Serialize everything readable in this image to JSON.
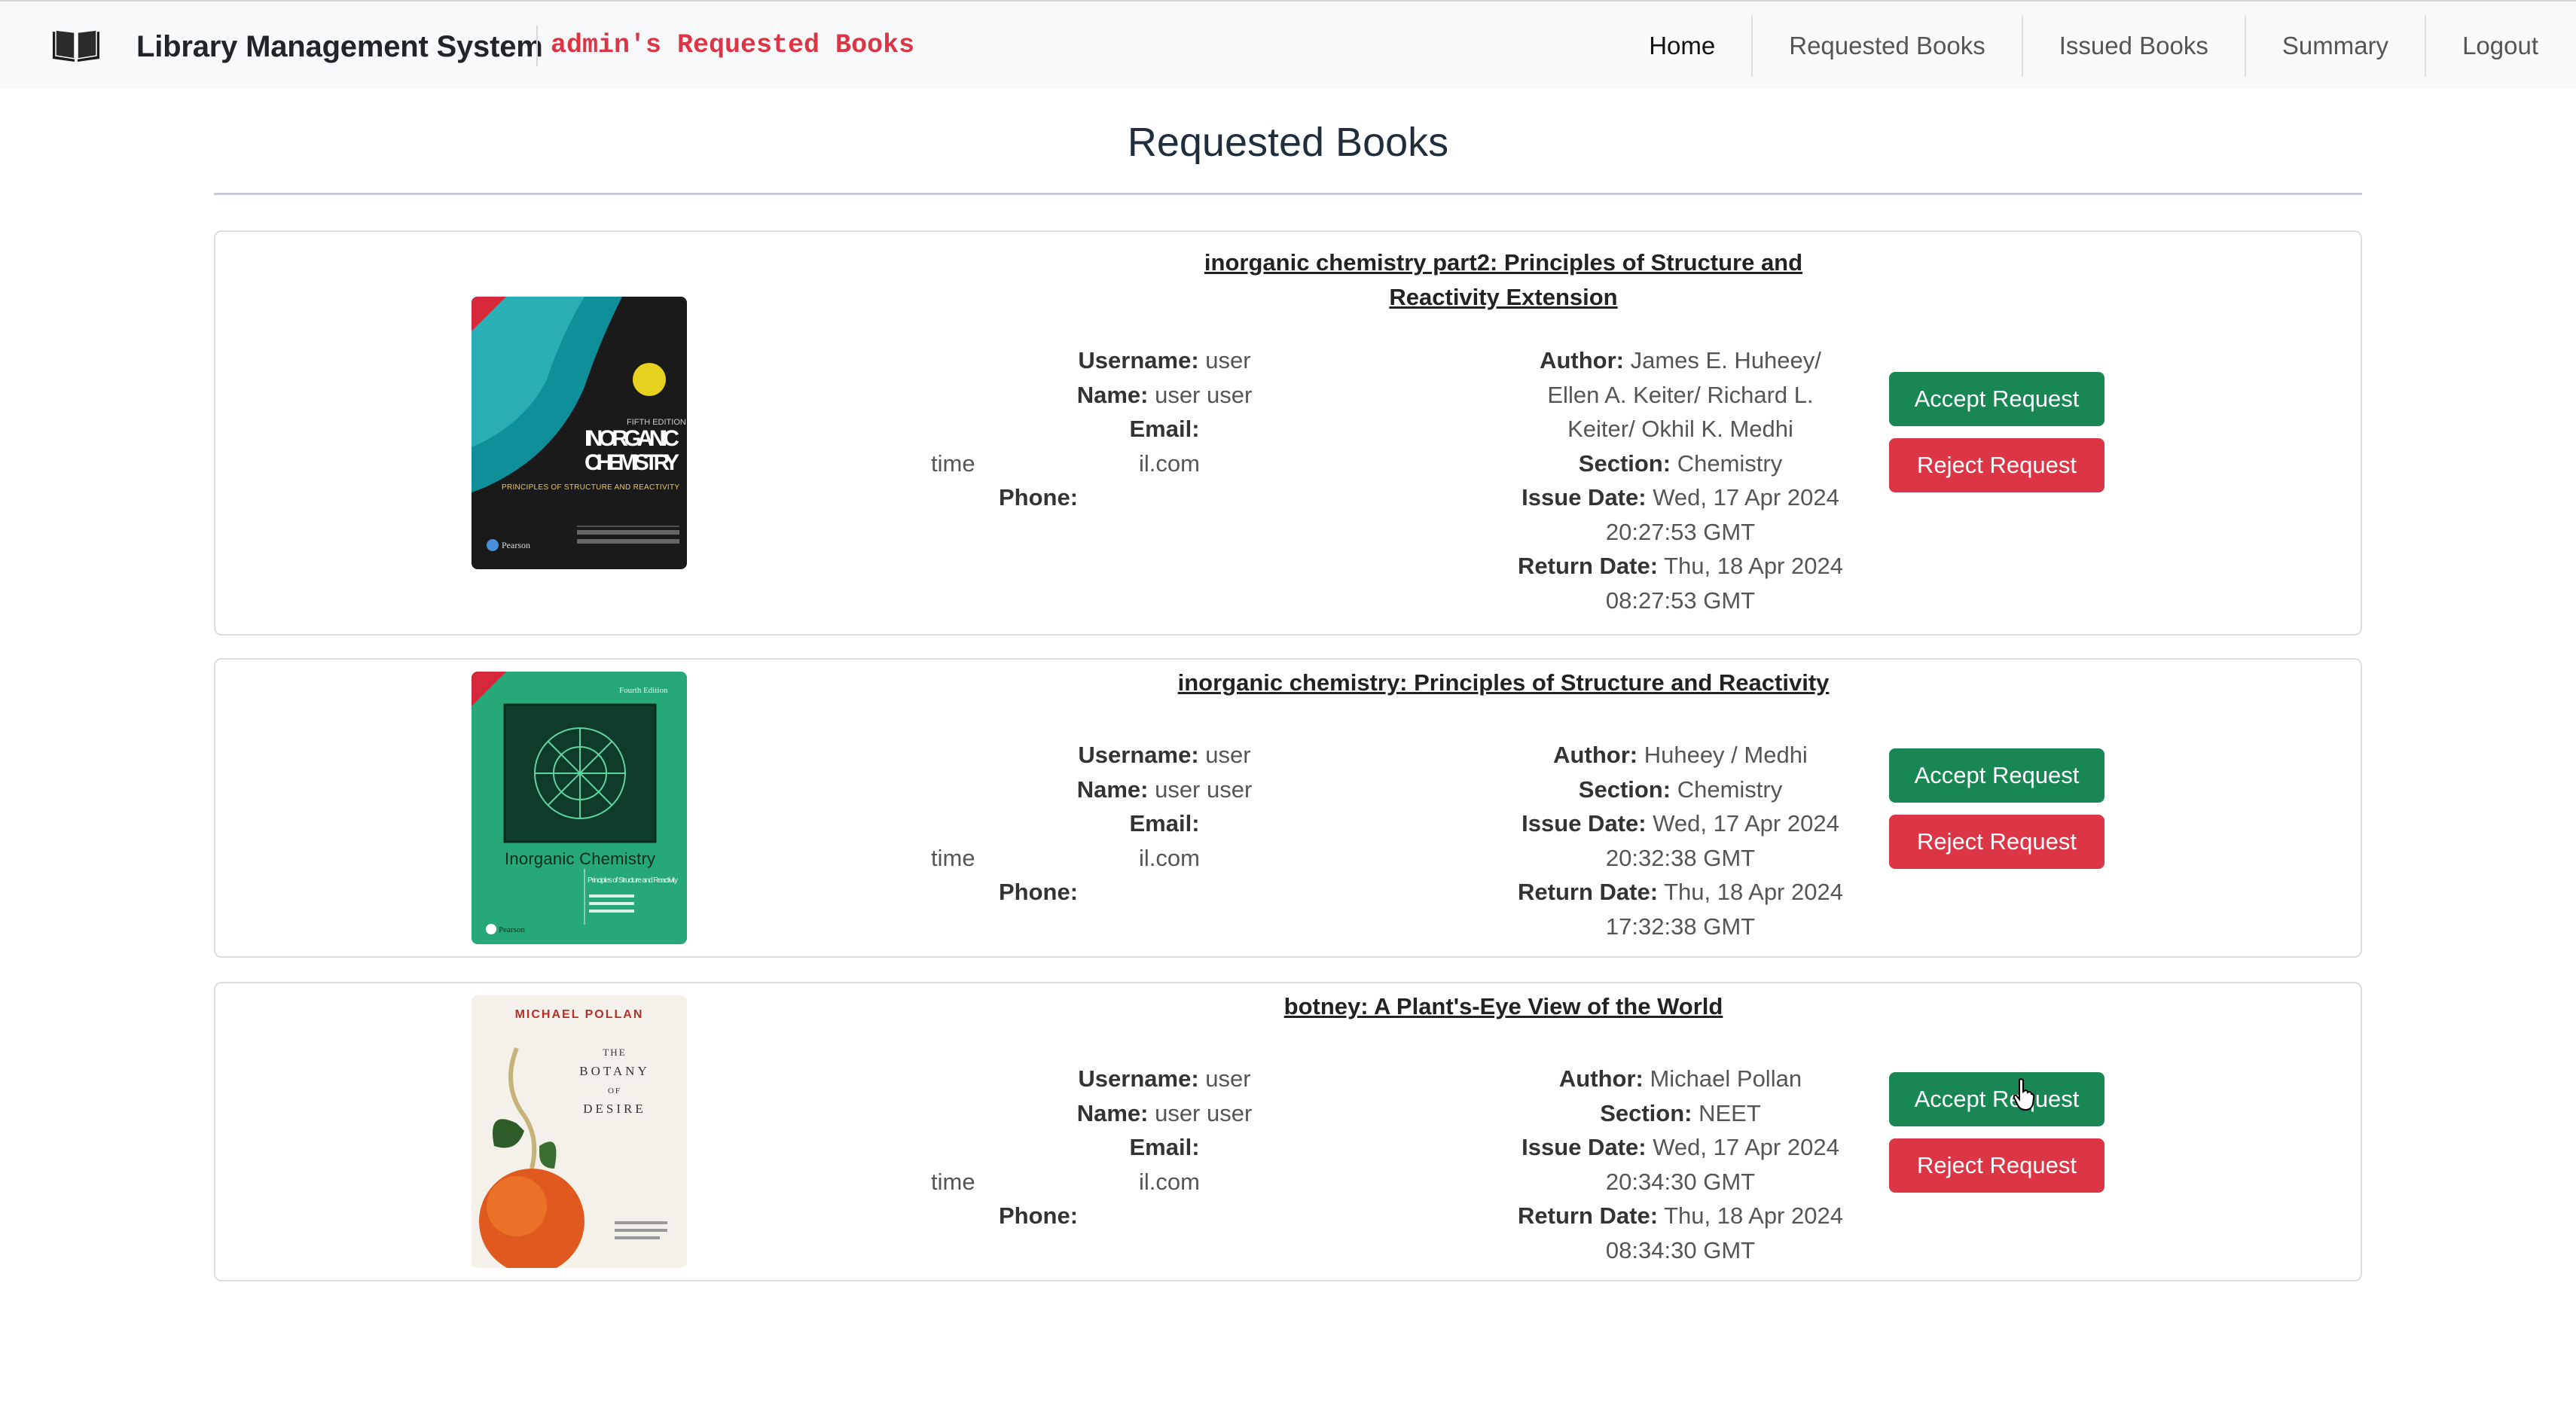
{
  "app": {
    "brand": "Library Management System",
    "page_label": "admin's Requested Books",
    "brand_icon": "open-book-icon"
  },
  "nav": {
    "links": [
      "Home",
      "Requested Books",
      "Issued Books",
      "Summary",
      "Logout"
    ],
    "active": "Home"
  },
  "page": {
    "title": "Requested Books"
  },
  "labels": {
    "username": "Username:",
    "name": "Name:",
    "email": "Email:",
    "phone": "Phone:",
    "author": "Author:",
    "section": "Section:",
    "issue_date": "Issue Date:",
    "return_date": "Return Date:",
    "accept": "Accept Request",
    "reject": "Reject Request"
  },
  "requests": [
    {
      "title_line1": "inorganic chemistry part2: Principles of Structure and",
      "title_line2": "Reactivity Extension",
      "username": "user",
      "name": "user user",
      "email_start": "time",
      "email_end": "il.com",
      "author_line1": "James E. Huheey/",
      "author_line2": "Ellen A. Keiter/ Richard L.",
      "author_line3": "Keiter/ Okhil K. Medhi",
      "section": "Chemistry",
      "issue_date_line1": "Wed, 17 Apr 2024",
      "issue_date_line2": "20:27:53 GMT",
      "return_date_line1": "Thu, 18 Apr 2024",
      "return_date_line2": "08:27:53 GMT",
      "cover": {
        "edition": "FIFTH EDITION",
        "line1": "INORGANIC",
        "line2": "CHEMISTRY",
        "subtitle": "PRINCIPLES OF STRUCTURE AND REACTIVITY",
        "publisher": "Pearson",
        "bg": "#0f8f9a"
      }
    },
    {
      "title_line1": "inorganic chemistry: Principles of Structure and Reactivity",
      "username": "user",
      "name": "user user",
      "email_start": "time",
      "email_end": "il.com",
      "author_line1": "Huheey / Medhi",
      "section": "Chemistry",
      "issue_date_line1": "Wed, 17 Apr 2024",
      "issue_date_line2": "20:32:38 GMT",
      "return_date_line1": "Thu, 18 Apr 2024",
      "return_date_line2": "17:32:38 GMT",
      "cover": {
        "edition": "Fourth Edition",
        "line1": "Inorganic Chemistry",
        "subtitle": "Principles of Structure and Reactivity",
        "publisher": "Pearson",
        "bg": "#27a878"
      }
    },
    {
      "title_line1": "botney: A Plant's-Eye View of the World",
      "username": "user",
      "name": "user user",
      "email_start": "time",
      "email_end": "il.com",
      "author_line1": "Michael Pollan",
      "section": "NEET",
      "issue_date_line1": "Wed, 17 Apr 2024",
      "issue_date_line2": "20:34:30 GMT",
      "return_date_line1": "Thu, 18 Apr 2024",
      "return_date_line2": "08:34:30 GMT",
      "cover": {
        "author": "MICHAEL POLLAN",
        "line1": "THE",
        "line2": "BOTANY",
        "line3": "OF",
        "line4": "DESIRE",
        "bg": "#f4f1ea"
      }
    }
  ]
}
